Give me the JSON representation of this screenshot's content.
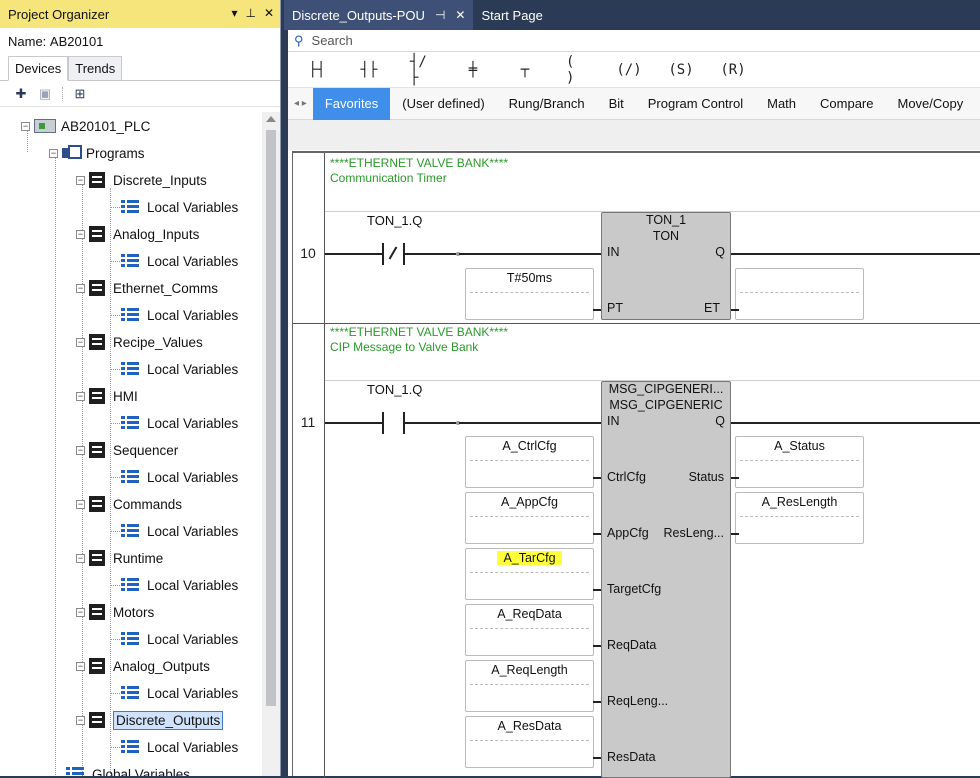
{
  "organizer": {
    "title": "Project Organizer",
    "name_label": "Name:",
    "name_value": "AB20101",
    "tabs": [
      "Devices",
      "Trends"
    ],
    "tree": {
      "root": "AB20101_PLC",
      "programs": "Programs",
      "items": [
        {
          "label": "Discrete_Inputs",
          "child": "Local Variables"
        },
        {
          "label": "Analog_Inputs",
          "child": "Local Variables"
        },
        {
          "label": "Ethernet_Comms",
          "child": "Local Variables"
        },
        {
          "label": "Recipe_Values",
          "child": "Local Variables"
        },
        {
          "label": "HMI",
          "child": "Local Variables"
        },
        {
          "label": "Sequencer",
          "child": "Local Variables"
        },
        {
          "label": "Commands",
          "child": "Local Variables"
        },
        {
          "label": "Runtime",
          "child": "Local Variables"
        },
        {
          "label": "Motors",
          "child": "Local Variables"
        },
        {
          "label": "Analog_Outputs",
          "child": "Local Variables"
        },
        {
          "label": "Discrete_Outputs",
          "child": "Local Variables"
        }
      ],
      "global": "Global Variables"
    }
  },
  "doc_tabs": {
    "active": "Discrete_Outputs-POU",
    "pin": "⊣",
    "close": "✕",
    "other": "Start Page"
  },
  "search": {
    "placeholder": "Search"
  },
  "categories": [
    "Favorites",
    "(User defined)",
    "Rung/Branch",
    "Bit",
    "Program Control",
    "Math",
    "Compare",
    "Move/Copy"
  ],
  "rungs": [
    {
      "number": "10",
      "comment1": "****ETHERNET VALVE BANK****",
      "comment2": "Communication Timer",
      "contact": "TON_1.Q",
      "block_name": "TON_1",
      "block_type": "TON",
      "in_pin": "IN",
      "q_pin": "Q",
      "pt_pin": "PT",
      "et_pin": "ET",
      "pt_value": "T#50ms"
    },
    {
      "number": "11",
      "comment1": "****ETHERNET VALVE BANK****",
      "comment2": "CIP Message to Valve Bank",
      "contact": "TON_1.Q",
      "block_name": "MSG_CIPGENERI...",
      "block_type": "MSG_CIPGENERIC",
      "in_pin": "IN",
      "q_pin": "Q",
      "inputs": [
        {
          "pin": "CtrlCfg",
          "value": "A_CtrlCfg"
        },
        {
          "pin": "AppCfg",
          "value": "A_AppCfg"
        },
        {
          "pin": "TargetCfg",
          "value": "A_TarCfg"
        },
        {
          "pin": "ReqData",
          "value": "A_ReqData"
        },
        {
          "pin": "ReqLeng...",
          "value": "A_ReqLength"
        },
        {
          "pin": "ResData",
          "value": "A_ResData"
        }
      ],
      "outputs": [
        {
          "pin": "Status",
          "value": "A_Status"
        },
        {
          "pin": "ResLeng...",
          "value": "A_ResLength"
        }
      ]
    }
  ],
  "colors": {
    "comment": "#2a9a2a",
    "highlight": "#ffff3a",
    "accent": "#3f8fea",
    "organizer_title": "#f5e57a"
  }
}
